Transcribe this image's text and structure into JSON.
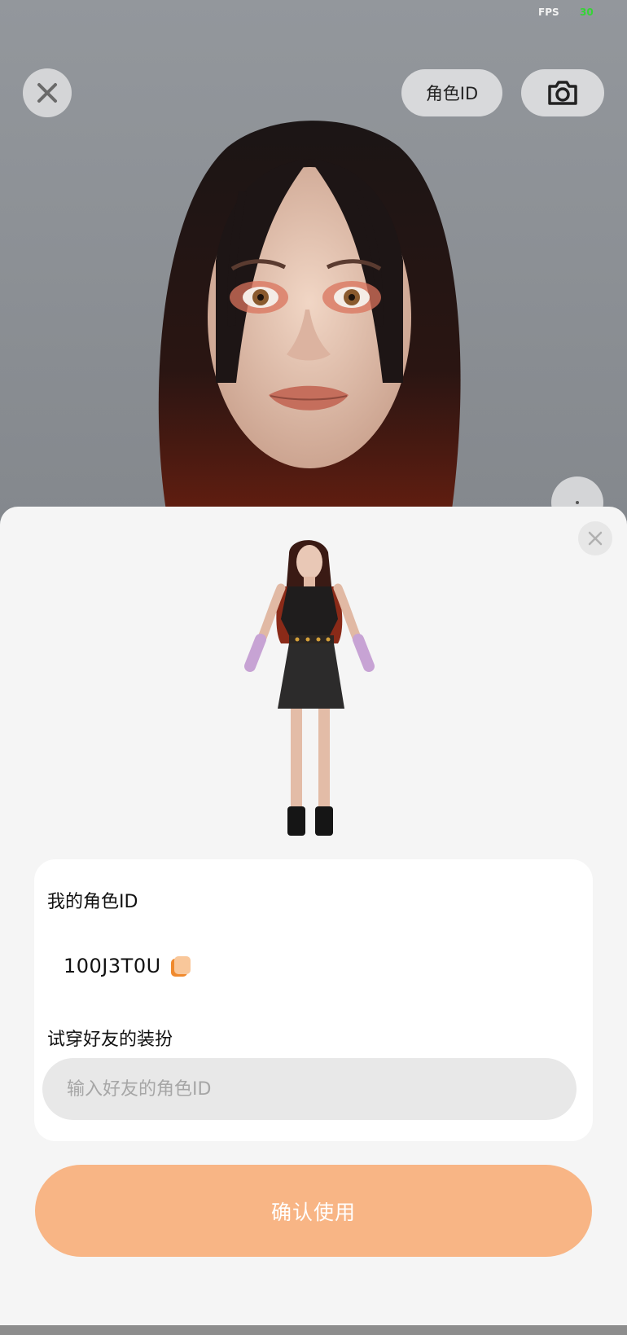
{
  "status": {
    "fps_label": "FPS",
    "fps_value": "30"
  },
  "toolbar": {
    "close_icon": "close-icon",
    "role_id_label": "角色ID",
    "camera_icon": "camera-icon"
  },
  "panel": {
    "my_id_title": "我的角色ID",
    "my_id_value": "100J3T0U",
    "copy_icon": "copy-icon",
    "try_on_label": "试穿好友的装扮",
    "friend_input_placeholder": "输入好友的角色ID",
    "friend_input_value": "",
    "confirm_label": "确认使用"
  },
  "colors": {
    "accent": "#f8b585",
    "copy_icon_dark": "#f08a2e",
    "copy_icon_light": "#f9c79a",
    "fps_value": "#35d435"
  }
}
